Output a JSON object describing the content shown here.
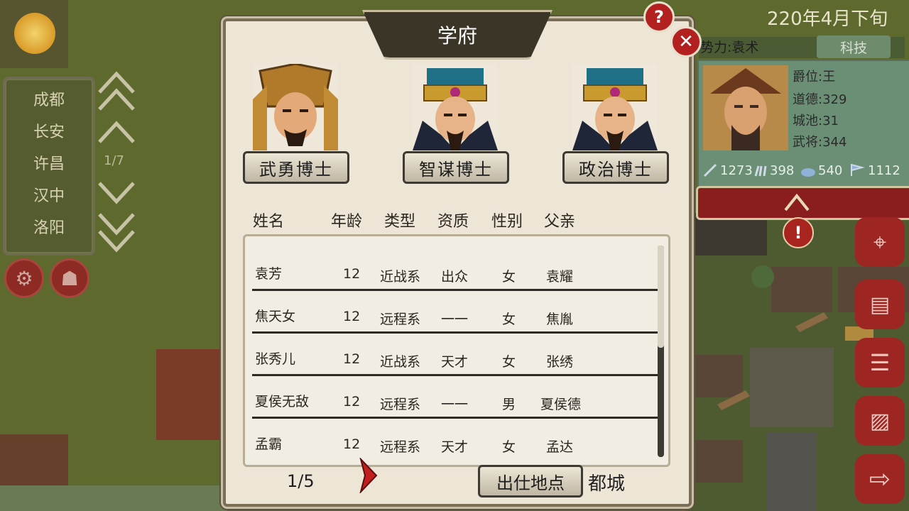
{
  "date": "220年4月下旬",
  "cities": [
    "成都",
    "长安",
    "许昌",
    "汉中",
    "洛阳"
  ],
  "city_page": "1/7",
  "dialog": {
    "title": "学府",
    "help_label": "?",
    "close_label": "✕",
    "doctors": [
      {
        "label": "武勇博士"
      },
      {
        "label": "智谋博士"
      },
      {
        "label": "政治博士"
      }
    ],
    "columns": [
      "姓名",
      "年龄",
      "类型",
      "资质",
      "性别",
      "父亲"
    ],
    "rows": [
      {
        "name": "袁芳",
        "age": "12",
        "type": "近战系",
        "aptitude": "出众",
        "gender": "女",
        "father": "袁耀"
      },
      {
        "name": "焦天女",
        "age": "12",
        "type": "远程系",
        "aptitude": "一一",
        "gender": "女",
        "father": "焦胤"
      },
      {
        "name": "张秀儿",
        "age": "12",
        "type": "近战系",
        "aptitude": "天才",
        "gender": "女",
        "father": "张绣"
      },
      {
        "name": "夏侯无敌",
        "age": "12",
        "type": "远程系",
        "aptitude": "一一",
        "gender": "男",
        "father": "夏侯德"
      },
      {
        "name": "孟霸",
        "age": "12",
        "type": "远程系",
        "aptitude": "天才",
        "gender": "女",
        "father": "孟达"
      }
    ],
    "page": "1/5",
    "origin_button": "出仕地点",
    "origin_value": "都城"
  },
  "faction": {
    "label": "势力:袁术",
    "tech_button": "科技",
    "stats": [
      "爵位:王",
      "道德:329",
      "城池:31",
      "武将:344"
    ],
    "resources": [
      "1273",
      "398",
      "540",
      "1112"
    ]
  },
  "colors": {
    "accent_red": "#b22020",
    "panel_green": "#6a8f74",
    "parchment": "#ede5d6"
  }
}
